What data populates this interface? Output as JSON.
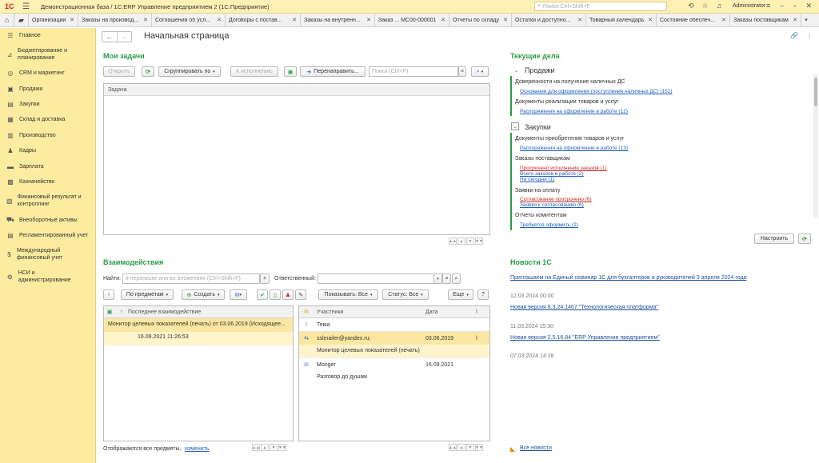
{
  "titlebar": {
    "logo": "1С",
    "title": "Демонстрационная база / 1С:ERP Управление предприятием 2  (1С:Предприятие)",
    "search_placeholder": "Поиск Ctrl+Shift+F",
    "user": "Administrator"
  },
  "tabs": [
    {
      "label": "Организации"
    },
    {
      "label": "Заказы на производ..."
    },
    {
      "label": "Соглашения об усл..."
    },
    {
      "label": "Договоры с постав..."
    },
    {
      "label": "Заказы на внутренн..."
    },
    {
      "label": "Заказ ... МС00-000001"
    },
    {
      "label": "Отчеты по складу"
    },
    {
      "label": "Остатки и доступно..."
    },
    {
      "label": "Товарный календарь"
    },
    {
      "label": "Состояние обеспеч..."
    },
    {
      "label": "Заказы поставщикам"
    }
  ],
  "sidebar": {
    "items": [
      {
        "label": "Главное",
        "icon": "menu-icon",
        "glyph": "☰"
      },
      {
        "label": "Бюджетирование и планирование",
        "icon": "chart-icon",
        "glyph": "⊿"
      },
      {
        "label": "CRM и маркетинг",
        "icon": "target-icon",
        "glyph": "◎"
      },
      {
        "label": "Продажи",
        "icon": "bag-icon",
        "glyph": "▣"
      },
      {
        "label": "Закупки",
        "icon": "cart-icon",
        "glyph": "▤"
      },
      {
        "label": "Склад и доставка",
        "icon": "warehouse-icon",
        "glyph": "▦"
      },
      {
        "label": "Производство",
        "icon": "factory-icon",
        "glyph": "▥"
      },
      {
        "label": "Кадры",
        "icon": "person-icon",
        "glyph": "♟"
      },
      {
        "label": "Зарплата",
        "icon": "wallet-icon",
        "glyph": "▬"
      },
      {
        "label": "Казначейство",
        "icon": "bank-icon",
        "glyph": "▩"
      },
      {
        "label": "Финансовый результат и контроллинг",
        "icon": "finance-icon",
        "glyph": "▧"
      },
      {
        "label": "Внеоборотные активы",
        "icon": "car-icon",
        "glyph": "⛟"
      },
      {
        "label": "Регламентированный учет",
        "icon": "ledger-icon",
        "glyph": "▤"
      },
      {
        "label": "Международный финансовый учет",
        "icon": "ifrs-icon",
        "glyph": "$"
      },
      {
        "label": "НСИ и администрирование",
        "icon": "gear-icon",
        "glyph": "⚙"
      }
    ]
  },
  "page": {
    "title": "Начальная страница"
  },
  "tasks": {
    "title": "Мои задачи",
    "open_label": "Открыть",
    "group_label": "Сгруппировать по",
    "execute_label": "К исполнению",
    "redirect_label": "Перенаправить...",
    "search_placeholder": "Поиск (Ctrl+F)",
    "column_task": "Задача"
  },
  "current": {
    "title": "Текущие дела",
    "groups": [
      {
        "title": "Продажи",
        "sections": [
          {
            "title": "Доверенности на получение наличных ДС",
            "links": [
              {
                "text": "Основания для оформления (поступление наличных ДС) (152)",
                "red": false
              }
            ]
          },
          {
            "title": "Документы реализации товаров и услуг",
            "links": [
              {
                "text": "Распоряжения на оформление в работе (12)",
                "red": false
              }
            ]
          }
        ]
      },
      {
        "title": "Закупки",
        "sections": [
          {
            "title": "Документы приобретения товаров и услуг",
            "links": [
              {
                "text": "Распоряжения на оформление в работе (13)",
                "red": false
              }
            ]
          },
          {
            "title": "Заказы поставщикам",
            "links": [
              {
                "text": "Просрочено исполнение заказов (1)",
                "red": true
              },
              {
                "text": "Всего заказов в работе (2)",
                "red": false
              },
              {
                "text": "На сегодня (1)",
                "red": false
              }
            ]
          },
          {
            "title": "Заявки на оплату",
            "links": [
              {
                "text": "Согласование просрочено (6)",
                "red": true
              },
              {
                "text": "Заявки к согласованию (6)",
                "red": false
              }
            ]
          },
          {
            "title": "Отчеты комитентам",
            "links": [
              {
                "text": "Требуется оформить (2)",
                "red": false
              }
            ]
          }
        ]
      }
    ],
    "setup_label": "Настроить"
  },
  "interactions": {
    "title": "Взаимодействия",
    "find_label": "Найти:",
    "find_placeholder": "в переписке или во вложениях (Ctrl+Shift+F)",
    "responsible_label": "Ответственный:",
    "by_subject_label": "По предметам",
    "create_label": "Создать",
    "show_label": "Показывать: Все",
    "status_label": "Статус: Все",
    "more_label": "Еще",
    "help_label": "?",
    "left_column": "Последнее взаимодействие",
    "left_sort": "↑",
    "left_rows": [
      {
        "text": "Монитор целевых показателей (печать) от 03.06.2019 (Исходящее..."
      },
      {
        "text": "16.09.2021 11:26:53"
      }
    ],
    "right_columns": {
      "participants": "Участники",
      "date": "Дата",
      "subject": "Тема"
    },
    "right_rows": [
      {
        "participants": "sslmailer@yandex.ru;",
        "date": "03.06.2019",
        "subject": "Монитор целевых показателей (печать)"
      },
      {
        "participants": "Monger",
        "date": "16.09.2021",
        "subject": "Разговор до душам"
      }
    ],
    "footer_text": "Отображаются все предметы,",
    "footer_link": "изменить"
  },
  "news": {
    "title": "Новости 1С",
    "items": [
      {
        "date": "",
        "text": "Приглашаем на Единый семинар 1С для бухгалтеров и руководителей 3 апреля 2024 года"
      },
      {
        "date": "12.03.2024 00:00",
        "text": "Новая версия 8.3.24.1467 \"Технологическая платформа\""
      },
      {
        "date": "11.03.2024 15:30",
        "text": "Новая версия 2.5.16.84 \"ERP Управление предприятием\""
      },
      {
        "date": "07.03.2024 14:28",
        "text": ""
      }
    ],
    "all_label": "Все новости"
  },
  "colors": {
    "accent_green": "#2a9c48",
    "sidebar_bg": "#fbec9f",
    "selection": "#fbe7a1",
    "link_blue": "#1f5fbd",
    "link_red": "#c62828"
  }
}
